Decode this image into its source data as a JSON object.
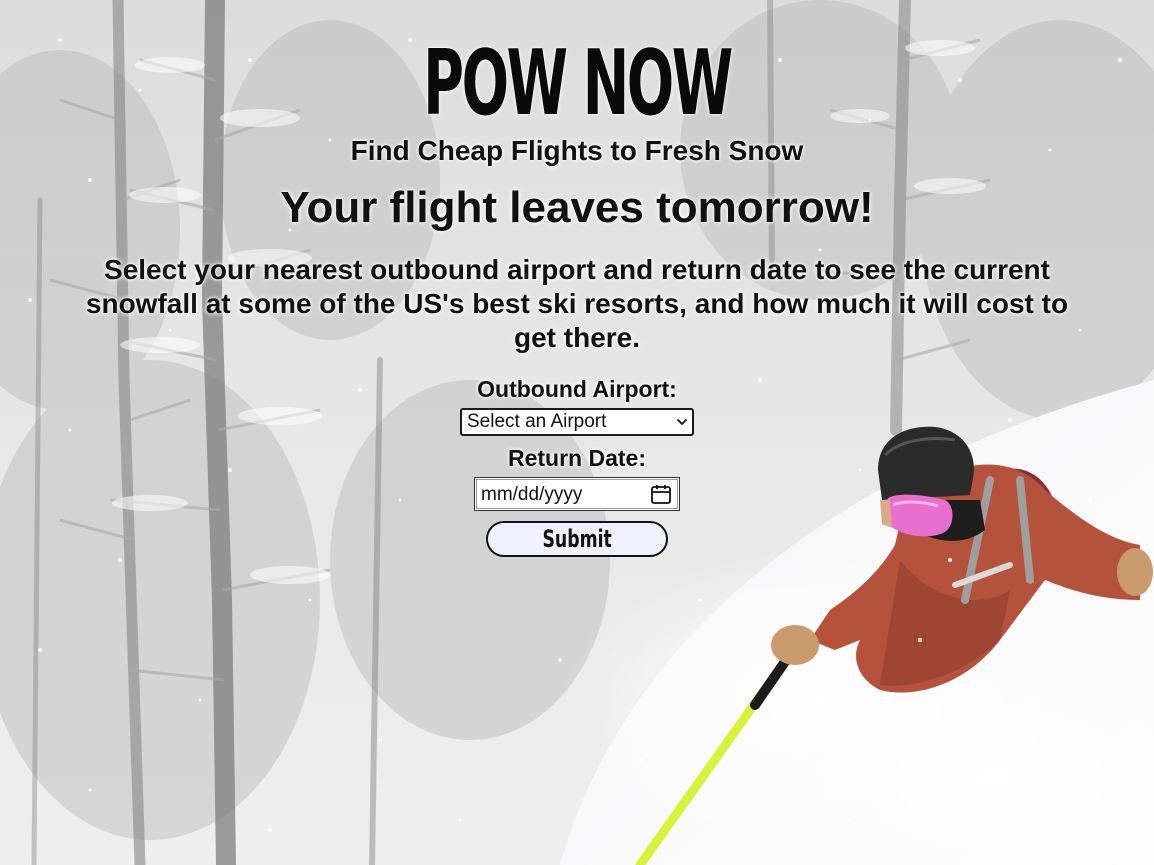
{
  "brand": {
    "logo": "POW NOW",
    "tagline": "Find Cheap Flights to Fresh Snow"
  },
  "hero": {
    "headline": "Your flight leaves tomorrow!",
    "description": "Select your nearest outbound airport and return date to see the current snowfall at some of the US's best ski resorts, and how much it will cost to get there."
  },
  "form": {
    "airport_label": "Outbound Airport:",
    "airport_selected": "Select an Airport",
    "return_label": "Return Date:",
    "return_placeholder": "mm/dd/yyyy",
    "submit_label": "Submit"
  },
  "icons": {
    "dropdown": "chevron-down-icon",
    "calendar": "calendar-icon"
  },
  "colors": {
    "text": "#111111",
    "button_bg": "#f1f0fe",
    "jacket": "#b5523c",
    "goggles": "#e86ed0",
    "pole": "#d8f23c"
  }
}
